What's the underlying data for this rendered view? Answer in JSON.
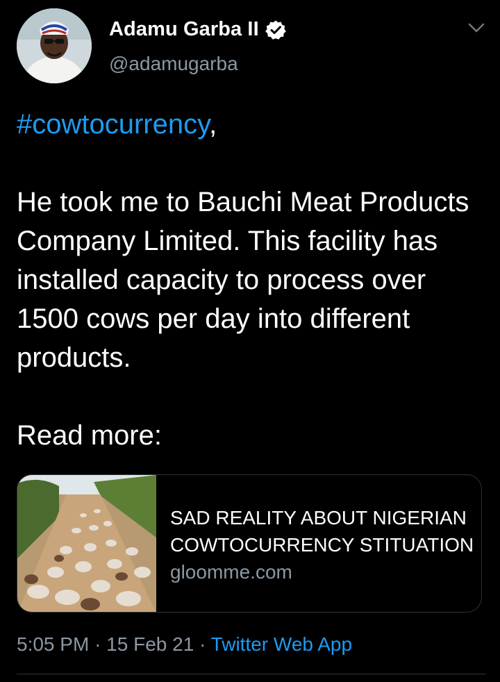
{
  "tweet": {
    "author": {
      "name": "Adamu Garba II",
      "handle": "@adamugarba",
      "verified": true,
      "avatar_icon": "profile-photo"
    },
    "hashtag": "#cowtocurrency",
    "hashtag_suffix": ",",
    "body": "He took me to Bauchi Meat Products Company Limited. This facility has installed capacity to process over 1500 cows per day into different products.",
    "read_more": "Read more:",
    "link_card": {
      "title": "SAD REALITY ABOUT NIGERIAN COWTOCURRENCY STITUATION",
      "domain": "gloomme.com",
      "thumbnail_icon": "cattle-herd-photo"
    },
    "time": "5:05 PM",
    "separator": "·",
    "date": "15 Feb 21",
    "source": "Twitter Web App"
  },
  "colors": {
    "background": "#000000",
    "text": "#ffffff",
    "secondary": "#8b98a5",
    "accent": "#1d9bf0",
    "border": "#2f3336"
  }
}
